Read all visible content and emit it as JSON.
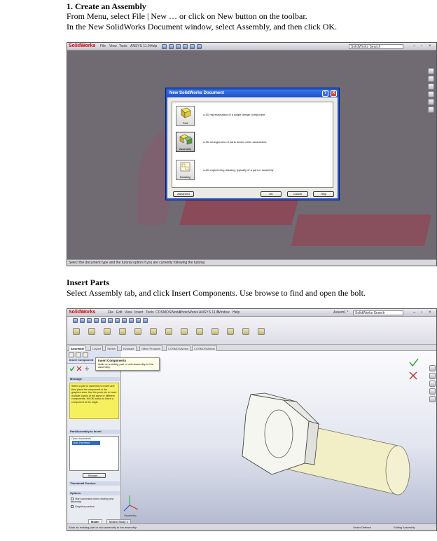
{
  "section1": {
    "heading": "1. Create an Assembly",
    "line1": "From  Menu, select File | New …  or click on New button on the toolbar.",
    "line2": "In the New SolidWorks Document window, select Assembly, and then click OK."
  },
  "section2": {
    "heading": "Insert Parts",
    "line1": "Select Assembly tab, and click Insert Components. Use browse to find and open the bolt."
  },
  "shot1": {
    "app_name": "SolidWorks",
    "menu": [
      "File",
      "View",
      "Tools",
      "ANSYS 11.0",
      "Help"
    ],
    "search_label": "SolidWorks Search",
    "dialog": {
      "title": "New SolidWorks Document",
      "help_button": "?",
      "close_button": "X",
      "types": [
        {
          "label": "Part",
          "description": "a 3D representation of a single design component"
        },
        {
          "label": "Assembly",
          "description": "a 3D arrangement of parts and/or other assemblies"
        },
        {
          "label": "Drawing",
          "description": "a 2D engineering drawing, typically of a part or assembly"
        }
      ],
      "advanced_button": "Advanced",
      "ok_button": "OK",
      "cancel_button": "Cancel",
      "help_label": "Help"
    },
    "status": "Select the document type and the tutorial option if you are currently following the tutorial."
  },
  "shot2": {
    "app_name": "SolidWorks",
    "menu": [
      "File",
      "Edit",
      "View",
      "Insert",
      "Tools",
      "COSMOSWorks",
      "PhotoWorks",
      "ANSYS 11.0",
      "Window",
      "Help"
    ],
    "doc_title": "Assem1 *",
    "search_label": "SolidWorks Search",
    "tabs": [
      "Assembly",
      "Layout",
      "Sketch",
      "Evaluate",
      "Office Products",
      "COSMOSWorks",
      "COSMOSMotion"
    ],
    "tooltip_title": "Insert Components",
    "tooltip_text": "Adds an existing part or sub-assembly to the assembly.",
    "pm_title": "Insert Component",
    "message_title": "Message",
    "message_text": "Select a part or assembly to insert and then place the component in the graphics area. Use the push pin to insert multiple copies of the same or different components. Hit OK button to insert a component at the origin.",
    "part_section": "Part/Assembly to Insert",
    "open_docs_label": "Open documents:",
    "open_doc_item": "Bolt_HexHead",
    "browse_button": "Browse...",
    "thumbnail_section": "Thumbnail Preview",
    "options_section": "Options",
    "option_start": "Start command when creating new assembly",
    "option_graphics": "Graphics preview",
    "bottom_tabs": [
      "Model",
      "Motion Study 1"
    ],
    "status_left": "Adds an existing part or sub-assembly to the assembly.",
    "status_mid": "Under Defined",
    "status_right": "Editing Assembly",
    "triad_label": "*Isometric"
  }
}
